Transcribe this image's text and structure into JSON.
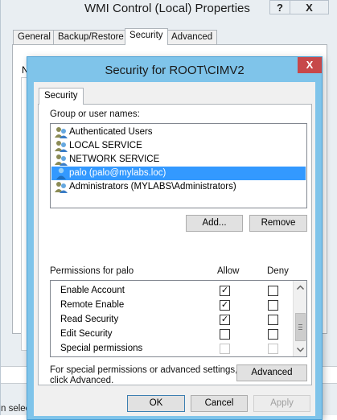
{
  "background_window": {
    "title": "WMI Control (Local) Properties",
    "help_label": "?",
    "close_label": "X",
    "tabs": [
      "General",
      "Backup/Restore",
      "Security",
      "Advanced"
    ],
    "active_tab": "Security",
    "panel_letter": "N",
    "status_text": "n selec"
  },
  "dialog": {
    "title": "Security for ROOT\\CIMV2",
    "close_label": "X",
    "tab": "Security",
    "group_label": "Group or user names:",
    "users": [
      {
        "name": "Authenticated Users",
        "icon": "user-group-icon",
        "selected": false
      },
      {
        "name": "LOCAL SERVICE",
        "icon": "user-group-icon",
        "selected": false
      },
      {
        "name": "NETWORK SERVICE",
        "icon": "user-group-icon",
        "selected": false
      },
      {
        "name": "palo (palo@mylabs.loc)",
        "icon": "single-user-icon",
        "selected": true
      },
      {
        "name": "Administrators (MYLABS\\Administrators)",
        "icon": "user-group-icon",
        "selected": false
      }
    ],
    "add_label": "Add...",
    "remove_label": "Remove",
    "permissions_label": "Permissions for palo",
    "allow_label": "Allow",
    "deny_label": "Deny",
    "permissions": [
      {
        "name": "Enable Account",
        "allow": true,
        "deny": false,
        "disabled": false
      },
      {
        "name": "Remote Enable",
        "allow": true,
        "deny": false,
        "disabled": false
      },
      {
        "name": "Read Security",
        "allow": true,
        "deny": false,
        "disabled": false
      },
      {
        "name": "Edit Security",
        "allow": false,
        "deny": false,
        "disabled": false
      },
      {
        "name": "Special permissions",
        "allow": false,
        "deny": false,
        "disabled": true
      }
    ],
    "special_text_line1": "For special permissions or advanced settings,",
    "special_text_line2": "click Advanced.",
    "advanced_label": "Advanced",
    "ok_label": "OK",
    "cancel_label": "Cancel",
    "apply_label": "Apply",
    "accent_color": "#7fc4ea",
    "selection_color": "#3399ff",
    "close_color": "#c7484a"
  }
}
